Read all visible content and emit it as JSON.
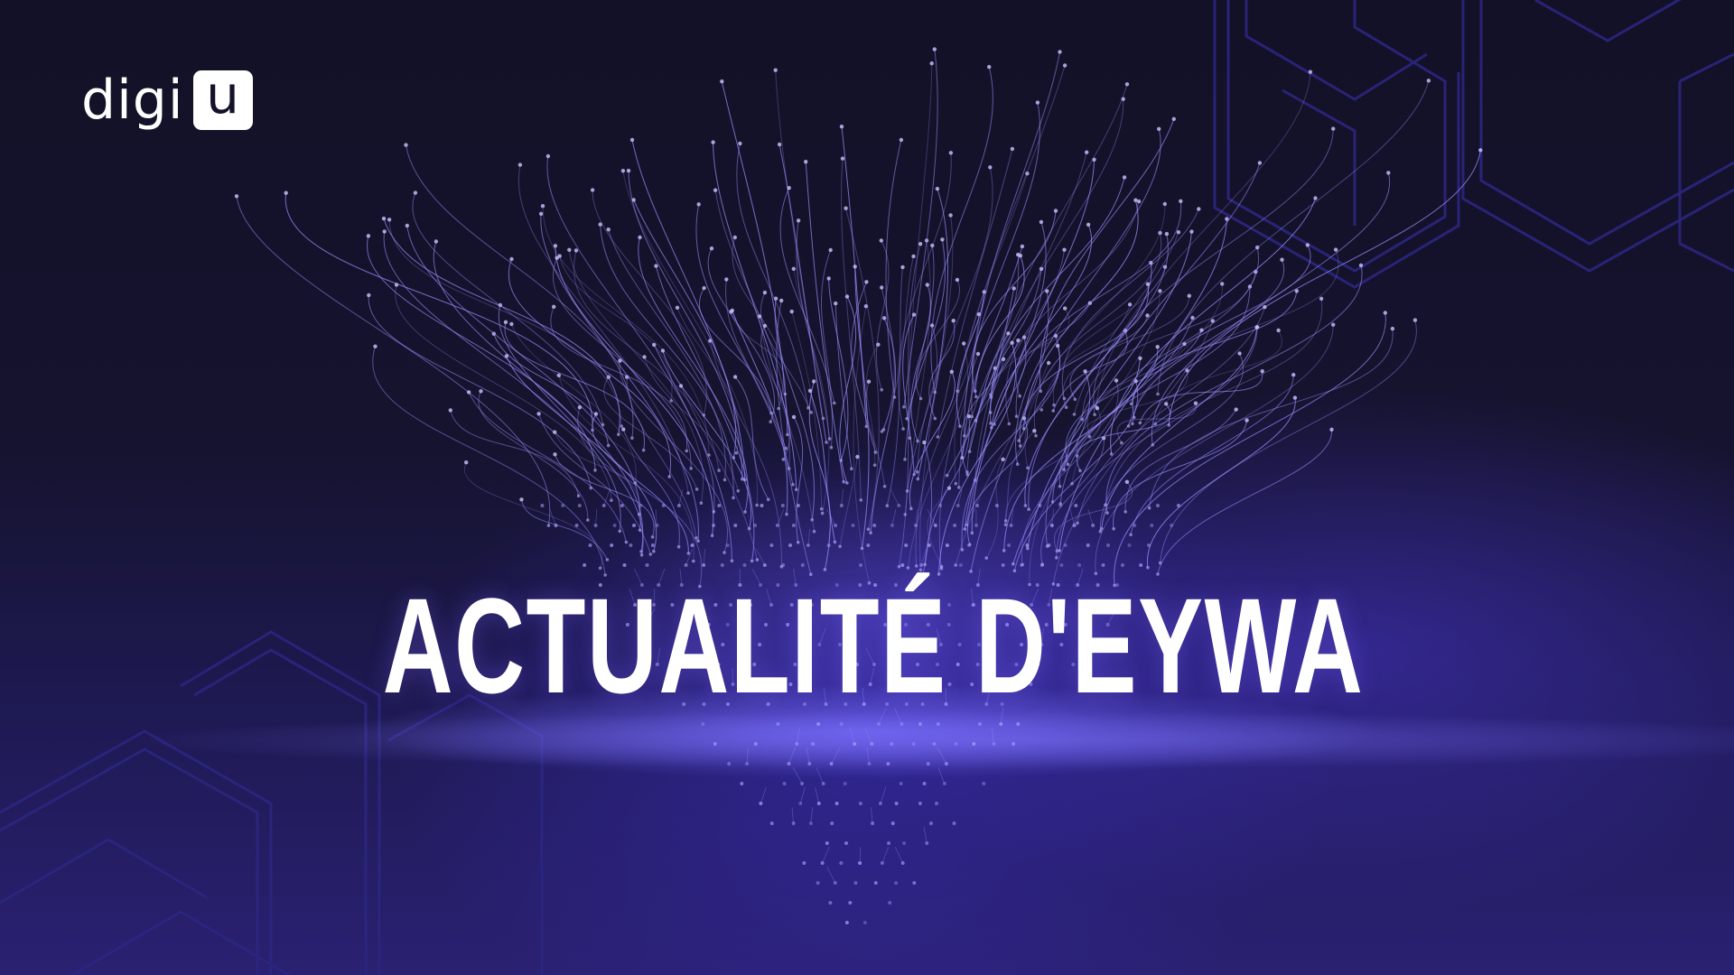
{
  "logo": {
    "text": "digi",
    "badge_letter": "u"
  },
  "headline": "ACTUALITÉ D'EYWA",
  "colors": {
    "background_dark": "#13122a",
    "accent_purple": "#4a3ad0",
    "particle_color": "#9a92ff",
    "text_white": "#ffffff"
  }
}
